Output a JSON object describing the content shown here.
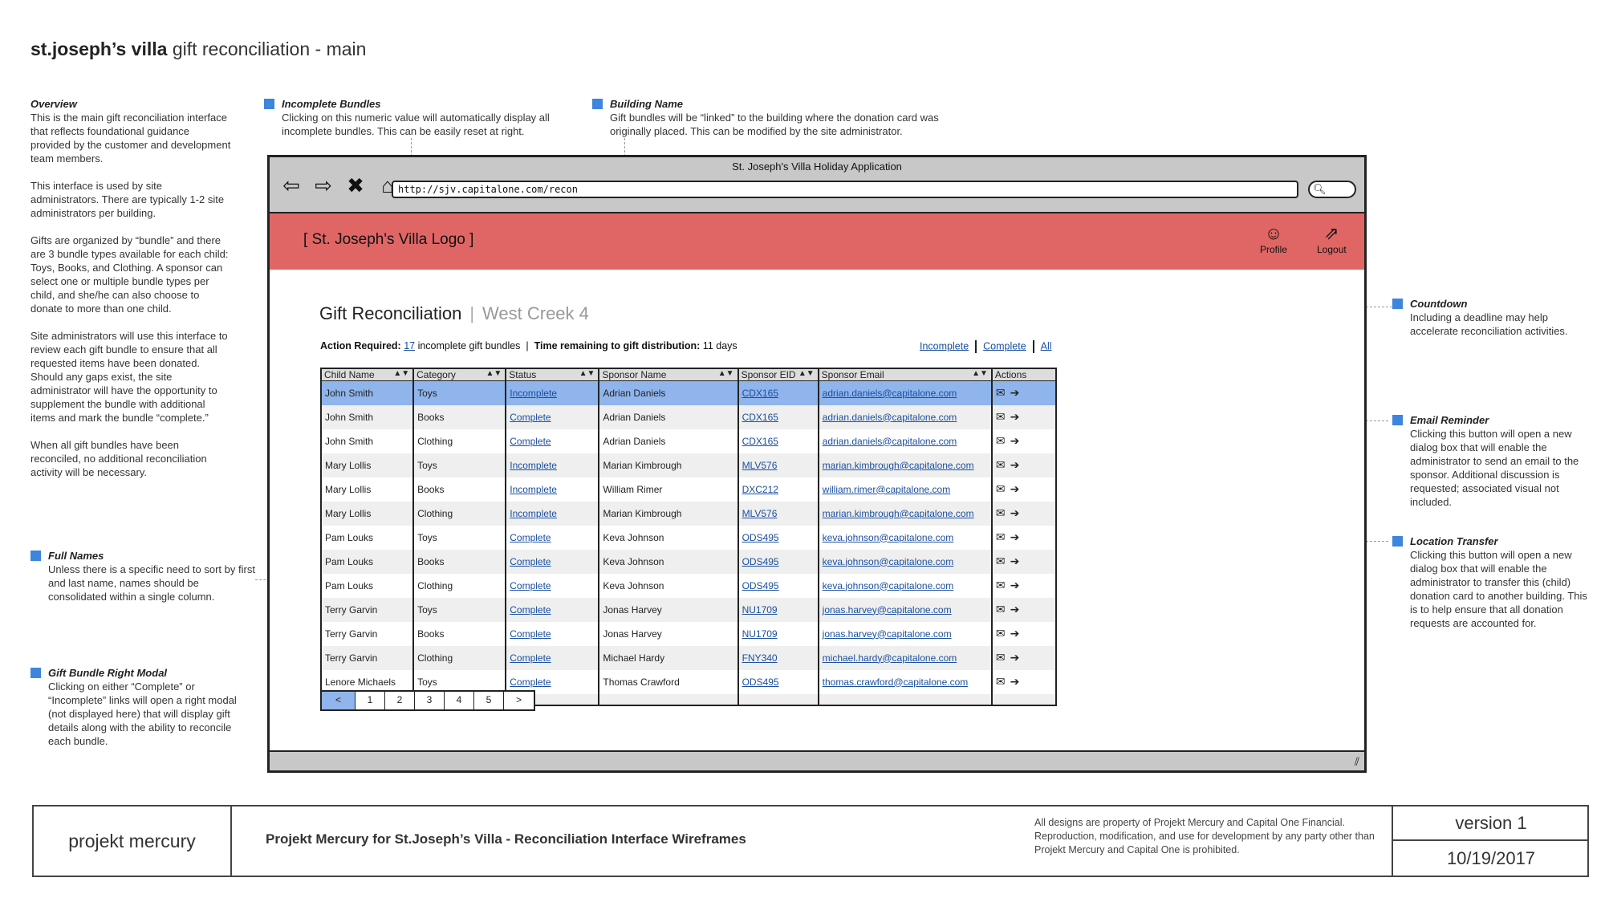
{
  "page_title": {
    "bold": "st.joseph’s villa",
    "rest": "gift reconciliation - main"
  },
  "notes": {
    "overview": {
      "heading": "Overview",
      "paragraphs": [
        "This is the main gift reconciliation interface that reflects foundational guidance provided by the customer and development team members.",
        "This interface is used by site administrators. There are typically 1-2 site administrators per building.",
        "Gifts are organized by “bundle” and there are 3 bundle types available for each child: Toys, Books, and Clothing. A sponsor can select one or multiple bundle types per child, and she/he can also choose to donate to more than one child.",
        "Site administrators will use this interface to review each gift bundle to ensure that all requested items have been donated. Should any gaps exist, the site administrator will have the opportunity to supplement the bundle with additional items and mark the bundle “complete.”",
        "When all gift bundles have been reconciled, no additional reconciliation activity will be necessary."
      ]
    },
    "full_names": {
      "heading": "Full Names",
      "body": "Unless there is a specific need to sort by first and last name, names should be consolidated within a single column."
    },
    "gift_modal": {
      "heading": "Gift Bundle Right Modal",
      "body": "Clicking on either “Complete” or “Incomplete” links will open a right modal (not displayed here) that will display gift details along with the ability to reconcile each bundle."
    },
    "incomplete": {
      "heading": "Incomplete Bundles",
      "body": "Clicking on this numeric value will automatically display all incomplete bundles. This can be easily reset at right."
    },
    "building": {
      "heading": "Building Name",
      "body": "Gift bundles will be “linked” to the building where the donation card was originally placed. This can be modified by the site administrator."
    },
    "countdown": {
      "heading": "Countdown",
      "body": "Including a deadline may help accelerate reconciliation activities."
    },
    "email": {
      "heading": "Email Reminder",
      "body": "Clicking this button will open a new dialog box that will enable the administrator to send an email to the sponsor. Additional discussion is requested; associated visual not included."
    },
    "transfer": {
      "heading": "Location Transfer",
      "body": "Clicking this button will open a new dialog box that will enable the administrator to transfer this (child) donation card to another building. This is to help ensure that all donation requests are accounted for."
    }
  },
  "browser": {
    "window_title": "St. Joseph's Villa Holiday Application",
    "url": "http://sjv.capitalone.com/recon",
    "icons": [
      "back-arrow-icon",
      "forward-arrow-icon",
      "close-icon",
      "home-icon"
    ]
  },
  "app": {
    "logo": "[ St. Joseph's Villa Logo ]",
    "profile_label": "Profile",
    "logout_label": "Logout",
    "title": "Gift Reconciliation",
    "separator": "|",
    "building": "West Creek 4",
    "action_label": "Action Required:",
    "incomplete_count": "17",
    "incomplete_text": "incomplete gift bundles",
    "pipe": "|",
    "time_label": "Time remaining to gift distribution:",
    "time_value": "11 days",
    "filters": {
      "incomplete": "Incomplete",
      "complete": "Complete",
      "all": "All"
    }
  },
  "table": {
    "columns": [
      "Child Name",
      "Category",
      "Status",
      "Sponsor Name",
      "Sponsor EID",
      "Sponsor Email",
      "Actions"
    ],
    "rows": [
      {
        "child": "John Smith",
        "category": "Toys",
        "status": "Incomplete",
        "sponsor": "Adrian Daniels",
        "eid": "CDX165",
        "email": "adrian.daniels@capitalone.com"
      },
      {
        "child": "John Smith",
        "category": "Books",
        "status": "Complete",
        "sponsor": "Adrian Daniels",
        "eid": "CDX165",
        "email": "adrian.daniels@capitalone.com"
      },
      {
        "child": "John Smith",
        "category": "Clothing",
        "status": "Complete",
        "sponsor": "Adrian Daniels",
        "eid": "CDX165",
        "email": "adrian.daniels@capitalone.com"
      },
      {
        "child": "Mary Lollis",
        "category": "Toys",
        "status": "Incomplete",
        "sponsor": "Marian Kimbrough",
        "eid": "MLV576",
        "email": "marian.kimbrough@capitalone.com"
      },
      {
        "child": "Mary Lollis",
        "category": "Books",
        "status": "Incomplete",
        "sponsor": "William Rimer",
        "eid": "DXC212",
        "email": "william.rimer@capitalone.com"
      },
      {
        "child": "Mary Lollis",
        "category": "Clothing",
        "status": "Incomplete",
        "sponsor": "Marian Kimbrough",
        "eid": "MLV576",
        "email": "marian.kimbrough@capitalone.com"
      },
      {
        "child": "Pam Louks",
        "category": "Toys",
        "status": "Complete",
        "sponsor": "Keva Johnson",
        "eid": "ODS495",
        "email": "keva.johnson@capitalone.com"
      },
      {
        "child": "Pam Louks",
        "category": "Books",
        "status": "Complete",
        "sponsor": "Keva Johnson",
        "eid": "ODS495",
        "email": "keva.johnson@capitalone.com"
      },
      {
        "child": "Pam Louks",
        "category": "Clothing",
        "status": "Complete",
        "sponsor": "Keva Johnson",
        "eid": "ODS495",
        "email": "keva.johnson@capitalone.com"
      },
      {
        "child": "Terry Garvin",
        "category": "Toys",
        "status": "Complete",
        "sponsor": "Jonas Harvey",
        "eid": "NU1709",
        "email": "jonas.harvey@capitalone.com"
      },
      {
        "child": "Terry Garvin",
        "category": "Books",
        "status": "Complete",
        "sponsor": "Jonas Harvey",
        "eid": "NU1709",
        "email": "jonas.harvey@capitalone.com"
      },
      {
        "child": "Terry Garvin",
        "category": "Clothing",
        "status": "Complete",
        "sponsor": "Michael Hardy",
        "eid": "FNY340",
        "email": "michael.hardy@capitalone.com"
      },
      {
        "child": "Lenore Michaels",
        "category": "Toys",
        "status": "Complete",
        "sponsor": "Thomas Crawford",
        "eid": "ODS495",
        "email": "thomas.crawford@capitalone.com"
      }
    ],
    "selected_row": 0
  },
  "pager": [
    "<",
    "1",
    "2",
    "3",
    "4",
    "5",
    ">"
  ],
  "footer": {
    "brand": "projekt mercury",
    "project": "Projekt Mercury for St.Joseph’s Villa - Reconciliation Interface Wireframes",
    "legal": "All designs are property of Projekt Mercury and Capital One Financial. Reproduction, modification, and use for development by any party other than Projekt Mercury and Capital One is prohibited.",
    "version": "version 1",
    "date": "10/19/2017"
  },
  "colors": {
    "header": "#e06666",
    "selected_row": "#8fb5ec",
    "note_marker": "#3d85dd",
    "link": "#1a4fa0"
  }
}
